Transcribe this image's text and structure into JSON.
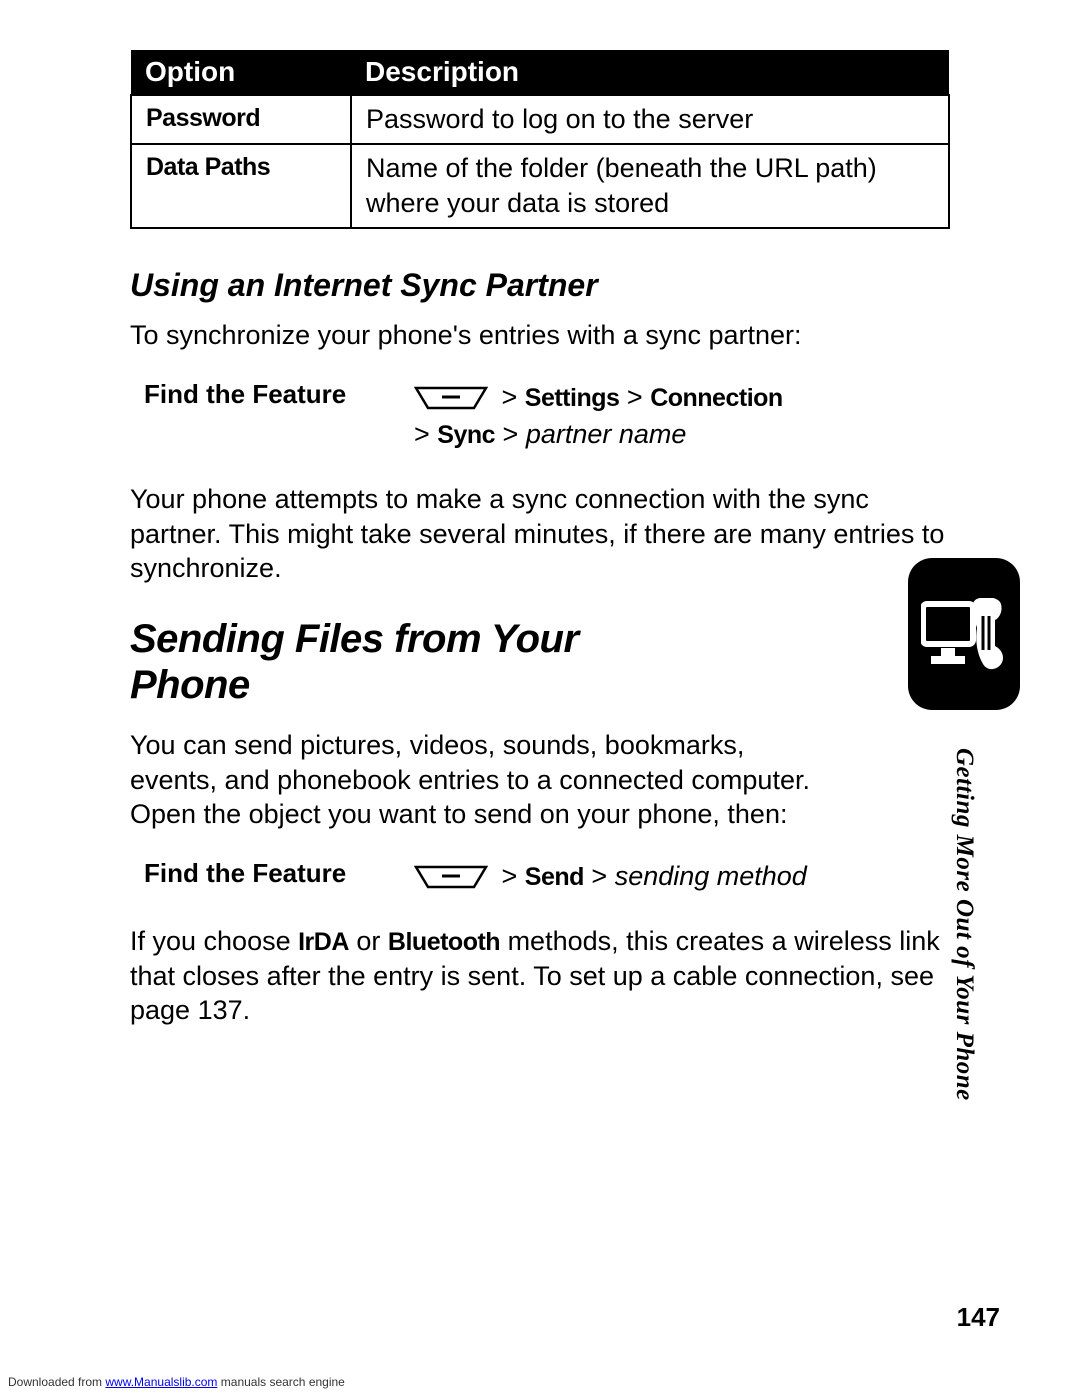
{
  "table": {
    "headers": {
      "option": "Option",
      "description": "Description"
    },
    "rows": [
      {
        "option": "Password",
        "description": "Password to log on to the server"
      },
      {
        "option": "Data Paths",
        "description": "Name of the folder (beneath the URL path) where your data is stored"
      }
    ]
  },
  "sub1": {
    "title": "Using an Internet Sync Partner",
    "intro": "To synchronize your phone's entries with a sync partner:",
    "feature_label": "Find the Feature",
    "path_line1_a": "Settings",
    "path_line1_b": "Connection",
    "path_line2_a": "Sync",
    "path_line2_b": "partner name",
    "gt": " > ",
    "after": "Your phone attempts to make a sync connection with the sync partner. This might take several minutes, if there are many entries to synchronize."
  },
  "section2": {
    "title": "Sending Files from Your Phone",
    "intro": "You can send pictures, videos, sounds, bookmarks, events, and phonebook entries to a connected computer. Open the object you want to send on your phone, then:",
    "feature_label": "Find the Feature",
    "path_a": "Send",
    "path_b": "sending method",
    "gt": " > ",
    "after_pre": "If you choose ",
    "after_irda": "IrDA",
    "after_or": " or ",
    "after_bt": "Bluetooth",
    "after_post": " methods, this creates a wireless link that closes after the entry is sent. To set up a cable connection, see page 137."
  },
  "side_label": "Getting More Out of Your Phone",
  "page_number": "147",
  "footer": {
    "pre": "Downloaded from ",
    "link": "www.Manualslib.com",
    "post": " manuals search engine"
  }
}
